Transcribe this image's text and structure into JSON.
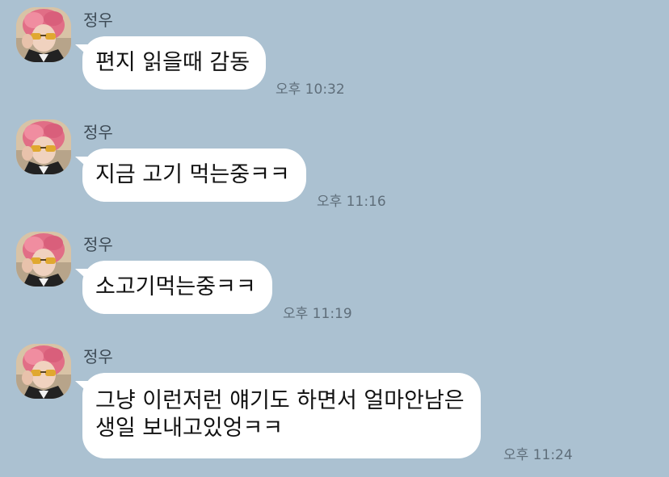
{
  "chat": {
    "background_color": "#abc1d1",
    "bubble_color": "#ffffff",
    "messages": [
      {
        "sender": "정우",
        "text": "편지 읽을때 감동",
        "time": "오후 10:32"
      },
      {
        "sender": "정우",
        "text": "지금 고기 먹는중ㅋㅋ",
        "time": "오후 11:16"
      },
      {
        "sender": "정우",
        "text": "소고기먹는중ㅋㅋ",
        "time": "오후 11:19"
      },
      {
        "sender": "정우",
        "lines": [
          "그냥 이런저런 얘기도 하면서 얼마안남은",
          "생일 보내고있엉ㅋㅋ"
        ],
        "time": "오후 11:24"
      }
    ]
  }
}
